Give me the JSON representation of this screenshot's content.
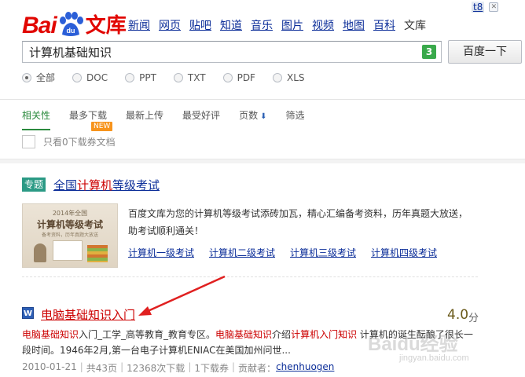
{
  "header": {
    "logo_bai": "Bai",
    "logo_du": "du",
    "logo_wenku": "文库",
    "nav": [
      "新闻",
      "网页",
      "贴吧",
      "知道",
      "音乐",
      "图片",
      "视频",
      "地图",
      "百科"
    ],
    "nav_current": "文库",
    "username": "t8"
  },
  "search": {
    "query": "计算机基础知识",
    "suggest_count": "3",
    "button_label": "百度一下"
  },
  "filetypes": [
    {
      "label": "全部",
      "selected": true
    },
    {
      "label": "DOC",
      "selected": false
    },
    {
      "label": "PPT",
      "selected": false
    },
    {
      "label": "TXT",
      "selected": false
    },
    {
      "label": "PDF",
      "selected": false
    },
    {
      "label": "XLS",
      "selected": false
    }
  ],
  "sort_tabs": [
    {
      "label": "相关性",
      "active": true
    },
    {
      "label": "最多下载",
      "active": false
    },
    {
      "label": "最新上传",
      "active": false
    },
    {
      "label": "最受好评",
      "active": false
    },
    {
      "label": "页数",
      "active": false
    },
    {
      "label": "筛选",
      "active": false
    }
  ],
  "new_tag": "NEW",
  "filter_checkbox_label": "只看0下载券文档",
  "topic": {
    "tag": "专题",
    "title_prefix": "全国",
    "title_highlight": "计算机",
    "title_suffix": "等级考试",
    "image": {
      "year_line": "2014年全国",
      "main_line": "计算机等级考试",
      "sub_line": "备考资料，历年真题大放送"
    },
    "description": "百度文库为您的计算机等级考试添砖加瓦，精心汇编备考资料，历年真题大放送，助考试顺利通关！",
    "links": [
      "计算机一级考试",
      "计算机二级考试",
      "计算机三级考试",
      "计算机四级考试"
    ]
  },
  "result": {
    "doc_type_icon": "W",
    "title": "电脑基础知识入门",
    "score": "4.0",
    "score_unit": "分",
    "summary_parts": [
      {
        "text": "电脑基础知识",
        "hl": true
      },
      {
        "text": "入门_工学_高等教育_教育专区。",
        "hl": false
      },
      {
        "text": "电脑基础知识",
        "hl": true
      },
      {
        "text": "介绍",
        "hl": false
      },
      {
        "text": "计算机入门知识",
        "hl": true
      },
      {
        "text": " 计算机的诞生酝酿了很长一段时间。1946年2月,第一台电子计算机ENIAC在美国加州问世...",
        "hl": false
      }
    ],
    "meta": {
      "date": "2010-01-21",
      "pages": "共43页",
      "downloads": "12368次下载",
      "coupons": "1下载券",
      "contributor_label": "贡献者：",
      "contributor": "chenhuogen"
    }
  },
  "watermark": {
    "brand": "Baidu经验",
    "url": "jingyan.baidu.com"
  },
  "colors": {
    "brand_red": "#e10601",
    "link_blue": "#0c2e99",
    "accent_green": "#2b8a3e",
    "highlight_red": "#cc0000"
  }
}
